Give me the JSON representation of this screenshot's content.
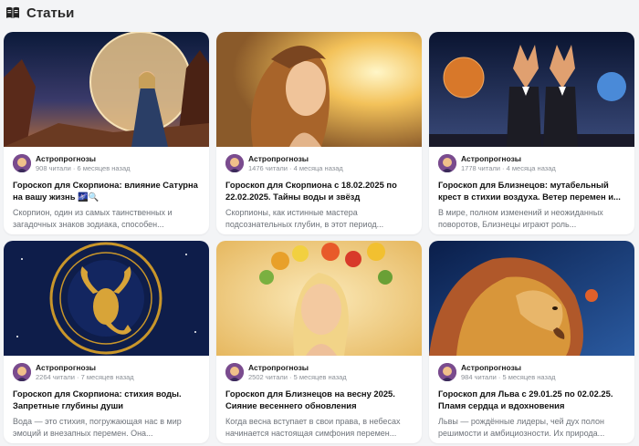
{
  "section": {
    "title": "Статьи",
    "icon": "articles-icon"
  },
  "cards": [
    {
      "author": "Астропрогнозы",
      "stats": "908 читали · 6 месяцев назад",
      "title": "Гороскоп для Скорпиона: влияние Сатурна на вашу жизнь 🌌🔍",
      "excerpt": "Скорпион, один из самых таинственных и загадочных знаков зодиака, способен..."
    },
    {
      "author": "Астропрогнозы",
      "stats": "1476 читали · 4 месяца назад",
      "title": "Гороскоп для Скорпиона с 18.02.2025 по 22.02.2025. Тайны воды и звёзд",
      "excerpt": "Скорпионы, как истинные мастера подсознательных глубин, в этот период..."
    },
    {
      "author": "Астропрогнозы",
      "stats": "1778 читали · 4 месяца назад",
      "title": "Гороскоп для Близнецов: мутабельный крест в стихии воздуха. Ветер перемен и...",
      "excerpt": "В мире, полном изменений и неожиданных поворотов, Близнецы играют роль..."
    },
    {
      "author": "Астропрогнозы",
      "stats": "2264 читали · 7 месяцев назад",
      "title": "Гороскоп для Скорпиона: стихия воды. Запретные глубины души",
      "excerpt": "Вода — это стихия, погружающая нас в мир эмоций и внезапных перемен. Она..."
    },
    {
      "author": "Астропрогнозы",
      "stats": "2502 читали · 5 месяцев назад",
      "title": "Гороскоп для Близнецов на весну 2025. Сияние весеннего обновления",
      "excerpt": "Когда весна вступает в свои права, в небесах начинается настоящая симфония перемен..."
    },
    {
      "author": "Астропрогнозы",
      "stats": "984 читали · 5 месяцев назад",
      "title": "Гороскоп для Льва с 29.01.25 по 02.02.25. Пламя сердца и вдохновения",
      "excerpt": "Львы — рождённые лидеры, чей дух полон решимости и амбициозности. Их природа..."
    }
  ]
}
